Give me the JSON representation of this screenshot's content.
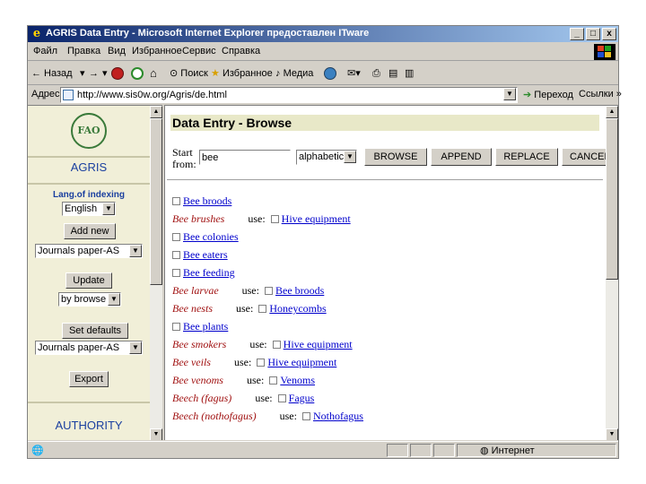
{
  "window": {
    "title": "AGRIS Data Entry - Microsoft Internet Explorer предоставлен ITware",
    "controls": {
      "minimize": "_",
      "maximize": "□",
      "close": "x"
    }
  },
  "menu": [
    "Файл",
    "Правка",
    "Вид",
    "Избранное",
    "Сервис",
    "Справка"
  ],
  "toolbar": {
    "back": "← Назад",
    "back_arrow": "▾",
    "forward": "→",
    "forward_arrow": "▾",
    "search": "Поиск",
    "favorites": "Избранное",
    "media": "Медиа"
  },
  "address": {
    "label": "Адрес",
    "url": "http://www.sis0w.org/Agris/de.html",
    "go": "Переход",
    "links": "Ссылки »"
  },
  "left": {
    "logo_text": "FAO",
    "agris_heading": "AGRIS",
    "lang_label": "Lang.of indexing",
    "lang_value": "English",
    "add_new": "Add new",
    "doctype_1": "Journals paper-AS",
    "update": "Update",
    "browse_mode": "by browse",
    "set_defaults": "Set defaults",
    "doctype_2": "Journals paper-AS",
    "export": "Export",
    "authority_heading": "AUTHORITY"
  },
  "main": {
    "title": "Data Entry - Browse",
    "start_label_1": "Start",
    "start_label_2": "from:",
    "start_value": "bee",
    "order_value": "alphabetic",
    "buttons": [
      "BROWSE",
      "APPEND",
      "REPLACE",
      "CANCEL"
    ],
    "use_word": "use:",
    "entries": [
      {
        "type": "descriptor",
        "text": "Bee broods"
      },
      {
        "type": "nondescriptor",
        "text": "Bee brushes",
        "target": "Hive equipment"
      },
      {
        "type": "descriptor",
        "text": "Bee colonies"
      },
      {
        "type": "descriptor",
        "text": "Bee eaters"
      },
      {
        "type": "descriptor",
        "text": "Bee feeding"
      },
      {
        "type": "nondescriptor",
        "text": "Bee larvae",
        "target": "Bee broods"
      },
      {
        "type": "nondescriptor",
        "text": "Bee nests",
        "target": "Honeycombs"
      },
      {
        "type": "descriptor",
        "text": "Bee plants"
      },
      {
        "type": "nondescriptor",
        "text": "Bee smokers",
        "target": "Hive equipment"
      },
      {
        "type": "nondescriptor",
        "text": "Bee veils",
        "target": "Hive equipment"
      },
      {
        "type": "nondescriptor",
        "text": "Bee venoms",
        "target": "Venoms"
      },
      {
        "type": "nondescriptor",
        "text": "Beech (fagus)",
        "target": "Fagus"
      },
      {
        "type": "nondescriptor",
        "text": "Beech (nothofagus)",
        "target": "Nothofagus"
      }
    ]
  },
  "status": {
    "zone": "Интернет"
  },
  "colors": {
    "title_start": "#0a246a",
    "title_end": "#a6caf0",
    "link": "#0000cc",
    "nondescriptor": "#a01010",
    "left_bg": "#f1efd8",
    "heading_blue": "#1a3f9f"
  },
  "icons": [
    "ie-icon",
    "windows-logo-icon",
    "back-icon",
    "forward-icon",
    "stop-icon",
    "refresh-icon",
    "home-icon",
    "search-icon",
    "favorites-icon",
    "media-icon",
    "history-icon",
    "mail-icon",
    "print-icon",
    "edit-icon",
    "discuss-icon",
    "page-icon",
    "go-icon",
    "fao-logo-icon",
    "internet-zone-icon"
  ]
}
